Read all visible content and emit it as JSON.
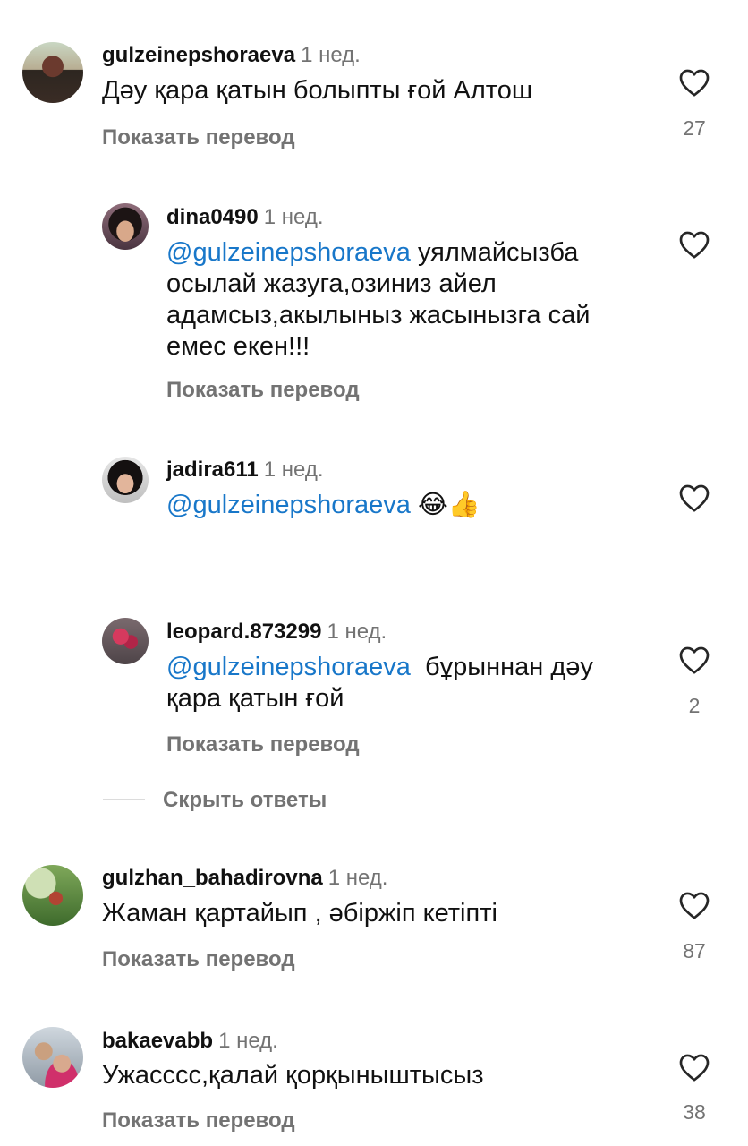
{
  "comments": [
    {
      "username": "gulzeinepshoraeva",
      "time": "1 нед.",
      "text": "Дәу қара қатын болыпты ғой Алтош",
      "translate": "Показать перевод",
      "likes": "27"
    },
    {
      "username": "dina0490",
      "time": "1 нед.",
      "mention": "@gulzeinepshoraeva",
      "text_after_mention": " уялмайсызба",
      "text_line2": "осылай жазуга,озиниз айел",
      "text_line3": "адамсыз,акылыныз жасынызга сай",
      "text_line4": "емес екен!!!",
      "translate": "Показать перевод",
      "likes": ""
    },
    {
      "username": "jadira611",
      "time": "1 нед.",
      "mention": "@gulzeinepshoraeva",
      "emoji": "😂👍",
      "likes": ""
    },
    {
      "username": "leopard.873299",
      "time": "1 нед.",
      "mention": "@gulzeinepshoraeva",
      "text_after_mention": "  бұрыннан дәу",
      "text_line2": "қара қатын ғой",
      "translate": "Показать перевод",
      "likes": "2"
    },
    {
      "username": "gulzhan_bahadirovna",
      "time": "1 нед.",
      "text": "Жаман қартайып , әбіржіп кетіпті",
      "translate": "Показать перевод",
      "likes": "87"
    },
    {
      "username": "bakaevabb",
      "time": "1 нед.",
      "text": "Ужасссс,қалай қорқыныштысыз",
      "translate": "Показать перевод",
      "likes": "38"
    }
  ],
  "hide_replies": "Скрыть ответы",
  "icons": {
    "like": "heart-outline-icon"
  },
  "colors": {
    "mention": "#1877c9",
    "secondary_text": "#737373"
  }
}
